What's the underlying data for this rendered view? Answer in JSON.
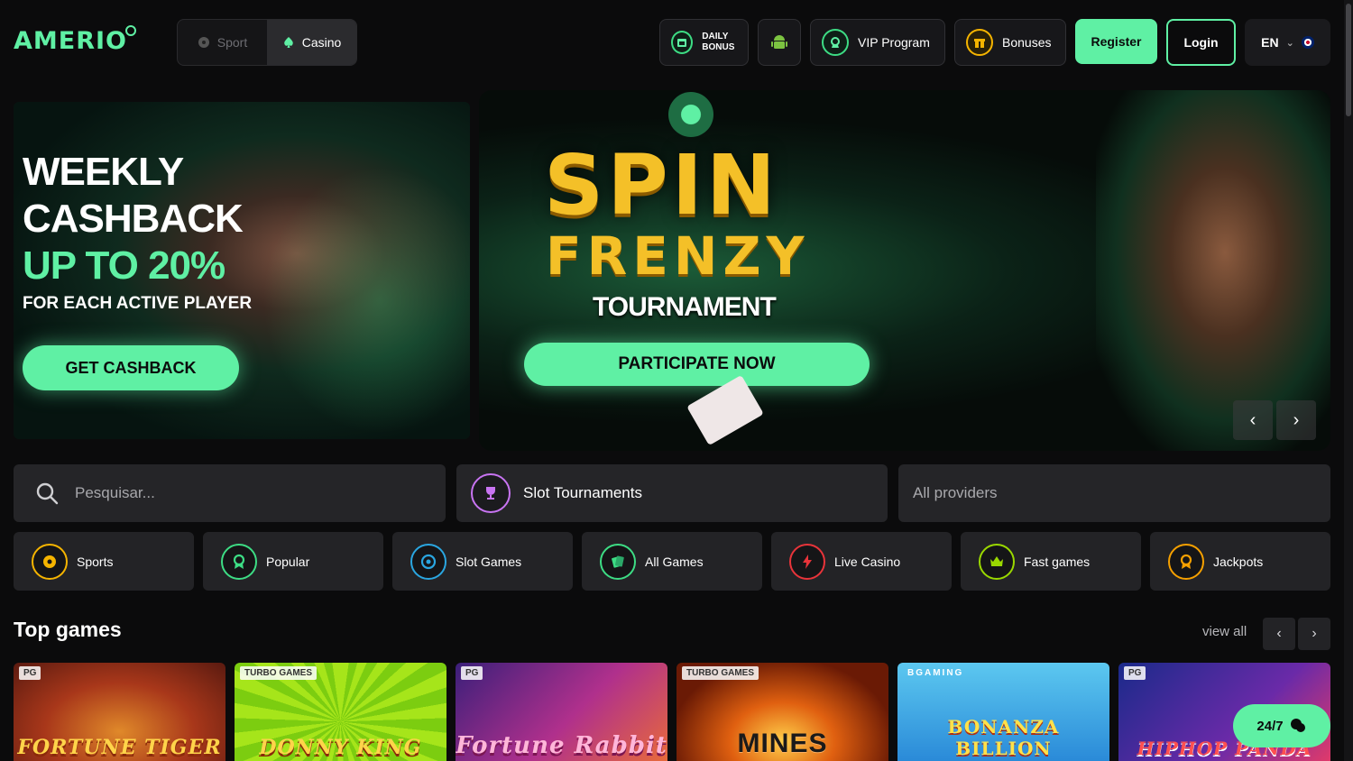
{
  "brand": {
    "logo_text": "AMERIO"
  },
  "header": {
    "mode_sport": "Sport",
    "mode_casino": "Casino",
    "daily_bonus": "DAILY BONUS",
    "vip": "VIP Program",
    "bonuses": "Bonuses",
    "register": "Register",
    "login": "Login",
    "language": "EN"
  },
  "banner_left": {
    "title": "WEEKLY CASHBACK",
    "highlight": "UP TO 20%",
    "subtitle": "FOR EACH ACTIVE PLAYER",
    "cta": "GET CASHBACK"
  },
  "banner_main": {
    "title_line1": "SPIN",
    "title_line2": "FRENZY",
    "subtitle": "TOURNAMENT",
    "cta": "PARTICIPATE NOW",
    "prev": "‹",
    "next": "›"
  },
  "search": {
    "placeholder": "Pesquisar..."
  },
  "slot_tournaments": "Slot Tournaments",
  "providers": "All providers",
  "categories": [
    {
      "label": "Sports",
      "color": "#f5b400"
    },
    {
      "label": "Popular",
      "color": "#3ddc84"
    },
    {
      "label": "Slot Games",
      "color": "#2aa6e0"
    },
    {
      "label": "All Games",
      "color": "#3ddc84"
    },
    {
      "label": "Live Casino",
      "color": "#e8343a"
    },
    {
      "label": "Fast games",
      "color": "#9ad800"
    },
    {
      "label": "Jackpots",
      "color": "#f5a000"
    }
  ],
  "top_games": {
    "title": "Top games",
    "view_all": "view all",
    "games": [
      {
        "name": "FORTUNE TIGER",
        "provider": "PG"
      },
      {
        "name": "DONNY KING",
        "provider": "TURBO GAMES"
      },
      {
        "name": "Fortune Rabbit",
        "provider": "PG"
      },
      {
        "name": "MINES",
        "provider": "TURBO GAMES"
      },
      {
        "name": "BONANZA BILLION",
        "provider": "BGAMING"
      },
      {
        "name": "HIPHOP PANDA",
        "provider": "PG"
      }
    ]
  },
  "support": "24/7",
  "colors": {
    "accent": "#5ff0a4",
    "background": "#0b0b0c",
    "panel": "#252528"
  }
}
